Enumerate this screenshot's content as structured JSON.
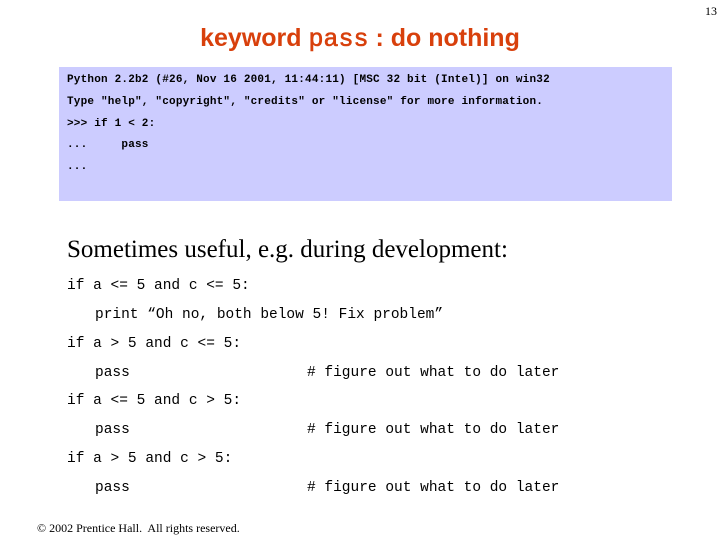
{
  "slide": {
    "page_number": "13",
    "title": {
      "prefix": "keyword ",
      "keyword": "pass",
      "suffix": " : do nothing"
    },
    "console": {
      "background": "#ccccff",
      "lines": [
        "Python 2.2b2 (#26, Nov 16 2001, 11:44:11) [MSC 32 bit (Intel)] on win32",
        "Type \"help\", \"copyright\", \"credits\" or \"license\" for more information.",
        ">>> if 1 < 2:",
        "...     pass",
        "..."
      ]
    },
    "subtitle": "Sometimes useful, e.g. during development:",
    "code": [
      {
        "text": "if a <= 5 and c <= 5:",
        "indent": false,
        "comment": ""
      },
      {
        "text": "print “Oh no, both below 5! Fix problem”",
        "indent": true,
        "comment": ""
      },
      {
        "text": "if a > 5 and c <= 5:",
        "indent": false,
        "comment": ""
      },
      {
        "text": "pass",
        "indent": true,
        "comment": "# figure out what to do later"
      },
      {
        "text": "if a <= 5 and c > 5:",
        "indent": false,
        "comment": ""
      },
      {
        "text": "pass",
        "indent": true,
        "comment": "# figure out what to do later"
      },
      {
        "text": "if a > 5 and c > 5:",
        "indent": false,
        "comment": ""
      },
      {
        "text": "pass",
        "indent": true,
        "comment": "# figure out what to do later"
      }
    ],
    "footer": "© 2002 Prentice Hall.  All rights reserved.",
    "colors": {
      "title": "#d8400c",
      "console_bg": "#ccccff"
    }
  }
}
